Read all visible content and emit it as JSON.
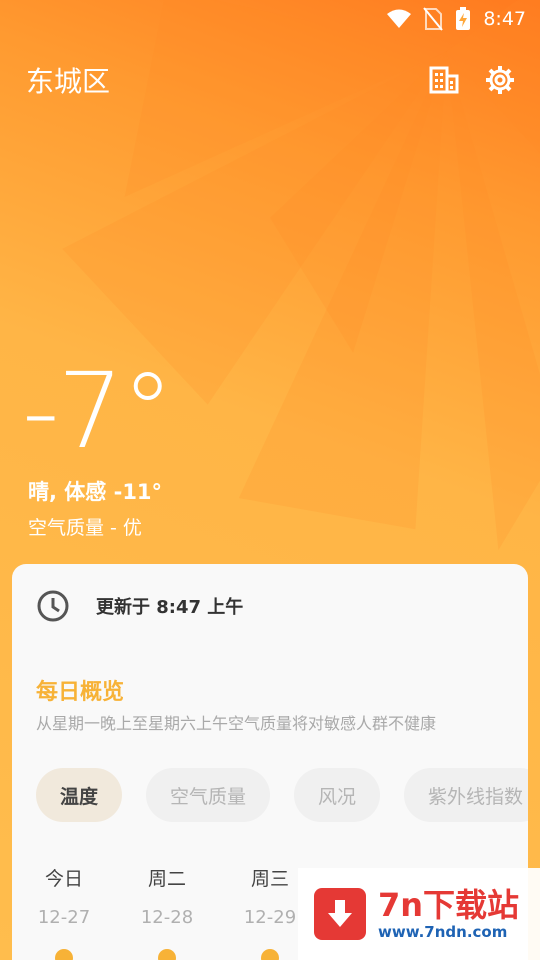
{
  "status_bar": {
    "time": "8:47",
    "icons": [
      "wifi-icon",
      "no-sim-icon",
      "battery-charging-icon"
    ]
  },
  "header": {
    "city": "东城区",
    "icons": [
      "buildings-icon",
      "settings-gear-icon"
    ]
  },
  "current": {
    "temperature": "-7°",
    "feels_like": "晴, 体感 -11°",
    "air_quality": "空气质量 - 优"
  },
  "card": {
    "updated": "更新于 8:47 上午",
    "overview_title": "每日概览",
    "overview_text": "从星期一晚上至星期六上午空气质量将对敏感人群不健康",
    "chips": [
      "温度",
      "空气质量",
      "风况",
      "紫外线指数"
    ],
    "days": [
      {
        "name": "今日",
        "date": "12-27"
      },
      {
        "name": "周二",
        "date": "12-28"
      },
      {
        "name": "周三",
        "date": "12-29"
      }
    ]
  },
  "watermark": {
    "title": "7n下载站",
    "url": "www.7ndn.com"
  },
  "colors": {
    "accent": "#f7b237",
    "sun_orange": "#ff7a1f",
    "watermark_red": "#e53935",
    "watermark_blue": "#1e63b4"
  }
}
